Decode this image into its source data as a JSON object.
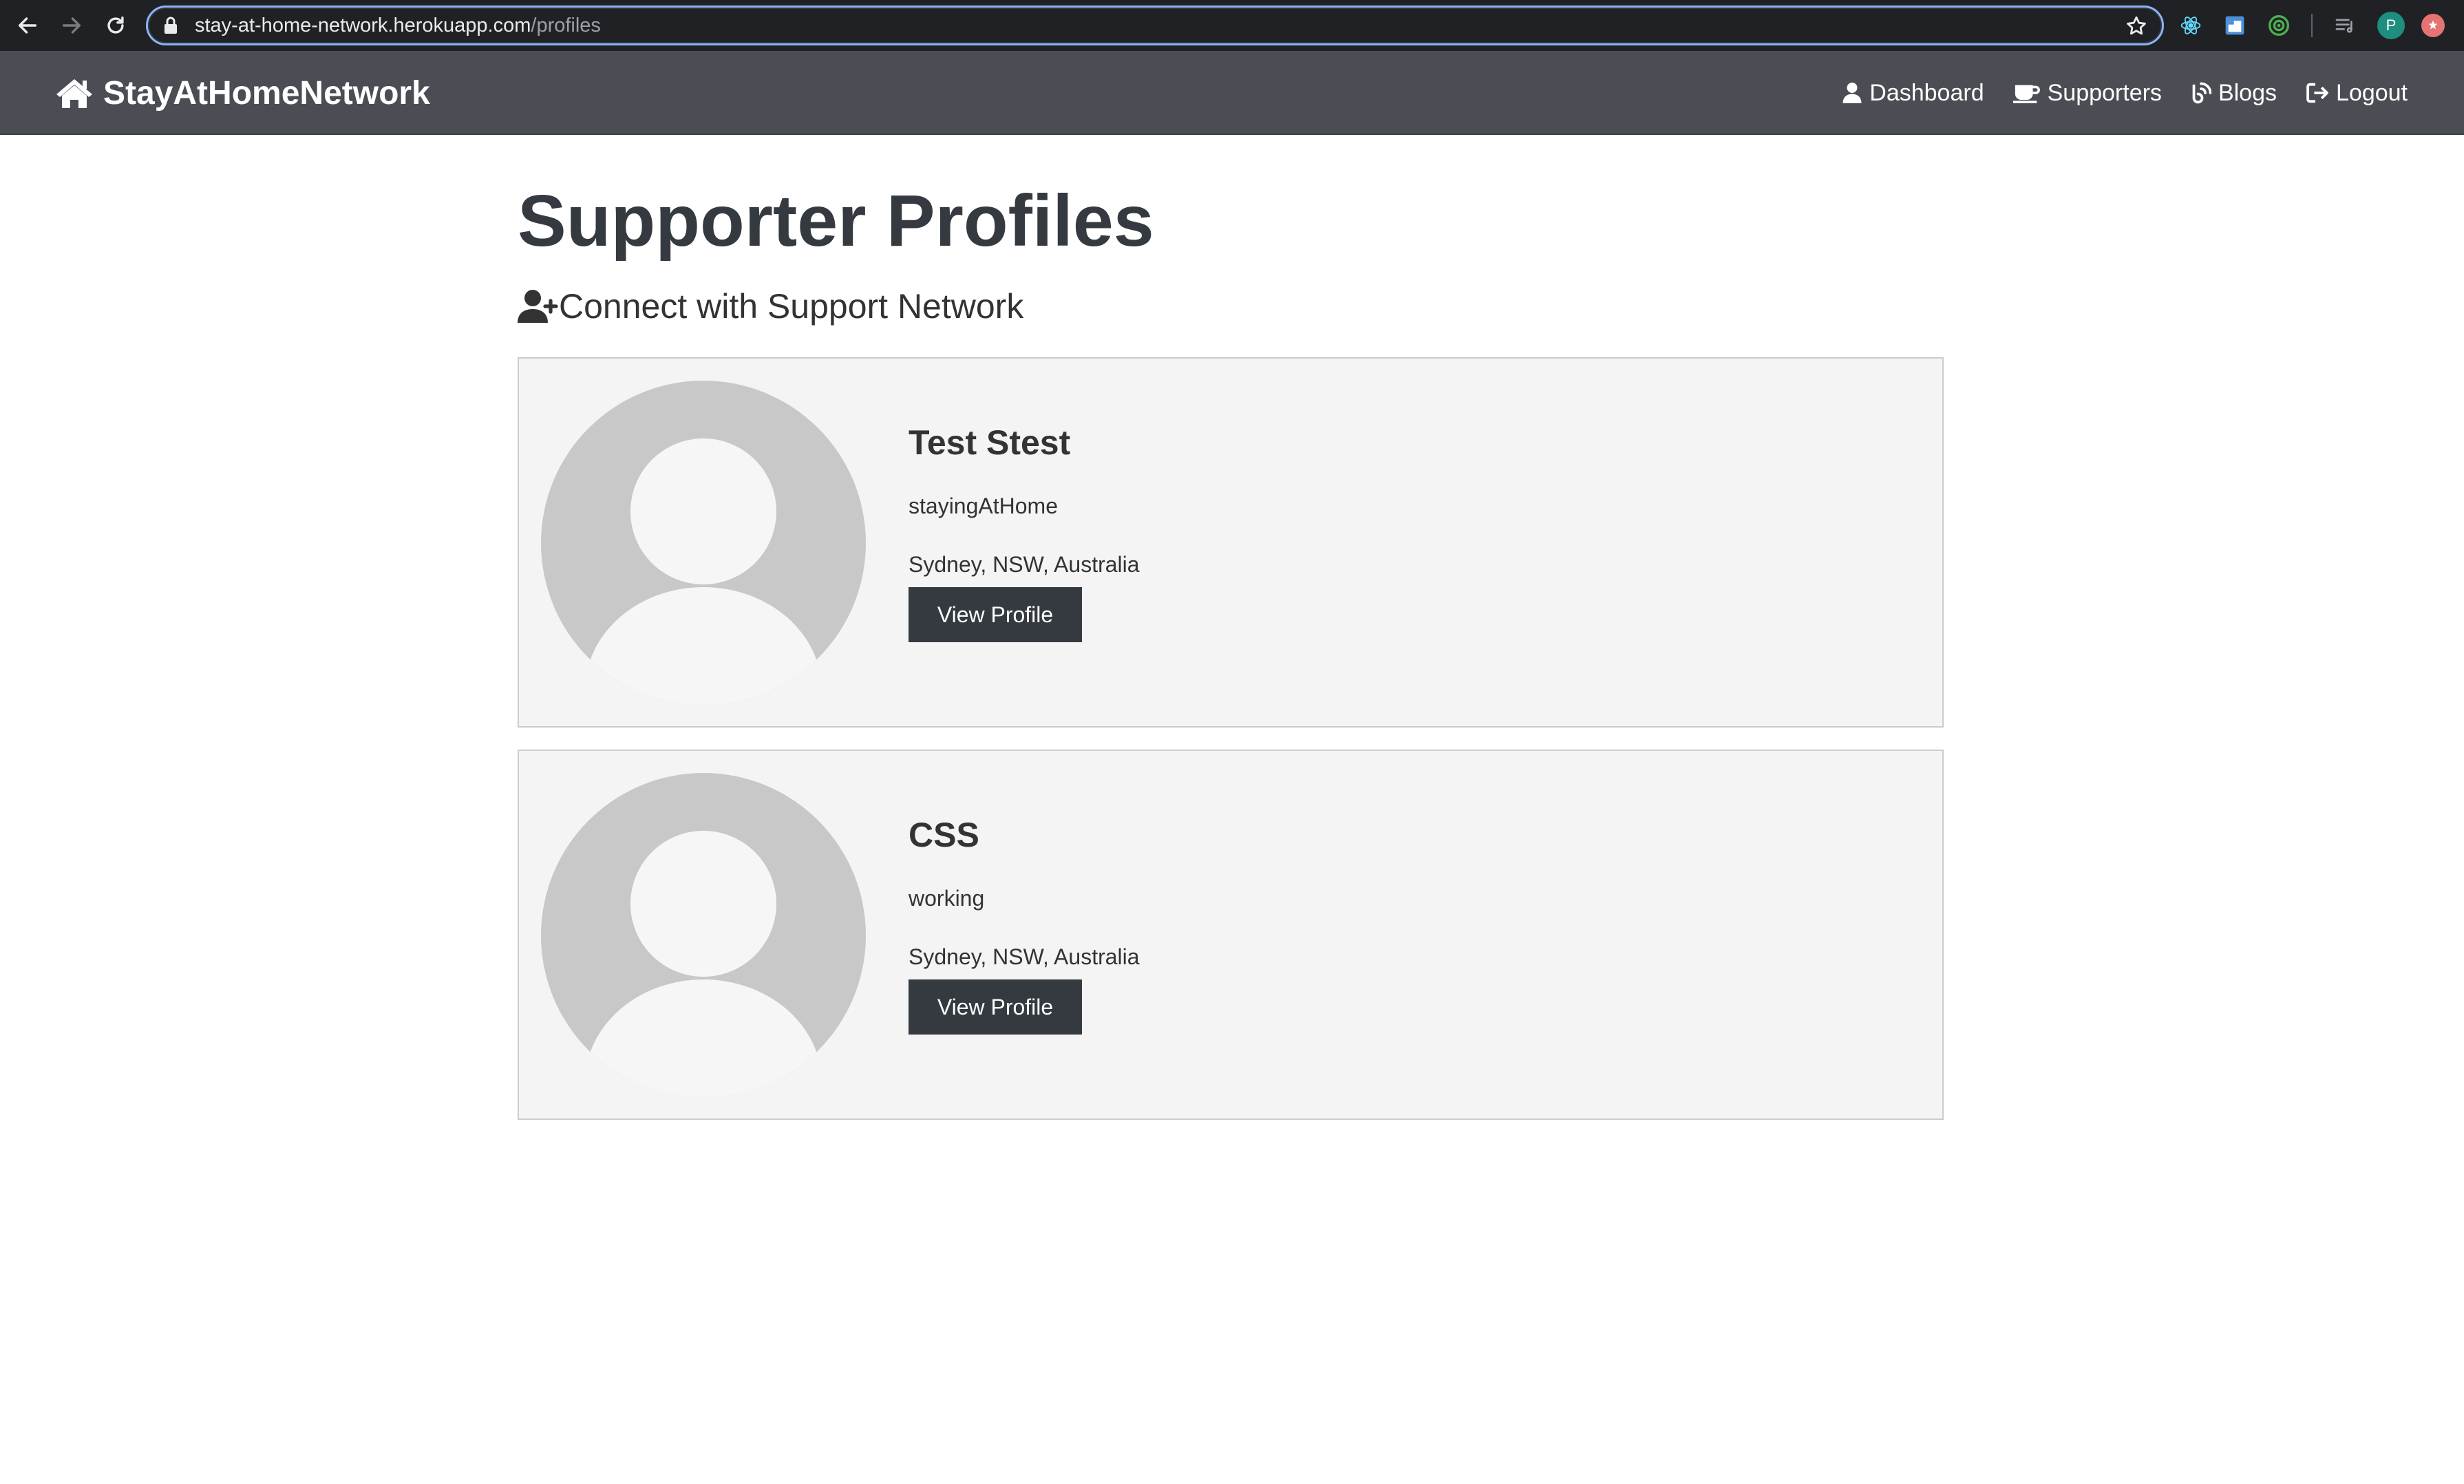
{
  "browser": {
    "url_host": "stay-at-home-network.herokuapp.com",
    "url_path": "/profiles",
    "profile_initial": "P"
  },
  "navbar": {
    "brand": "StayAtHomeNetwork",
    "links": [
      {
        "label": "Dashboard",
        "icon": "user-icon"
      },
      {
        "label": "Supporters",
        "icon": "coffee-icon"
      },
      {
        "label": "Blogs",
        "icon": "blog-icon"
      },
      {
        "label": "Logout",
        "icon": "sign-out-icon"
      }
    ]
  },
  "main": {
    "title": "Supporter Profiles",
    "lead": "Connect with Support Network",
    "profiles": [
      {
        "name": "Test Stest",
        "status": "stayingAtHome",
        "location": "Sydney, NSW, Australia",
        "button": "View Profile"
      },
      {
        "name": "CSS",
        "status": "working",
        "location": "Sydney, NSW, Australia",
        "button": "View Profile"
      }
    ]
  },
  "colors": {
    "navbar_bg": "#4a4e54",
    "button_bg": "#343a40",
    "card_bg": "#f4f4f4",
    "avatar_bg": "#c8c8c8"
  }
}
